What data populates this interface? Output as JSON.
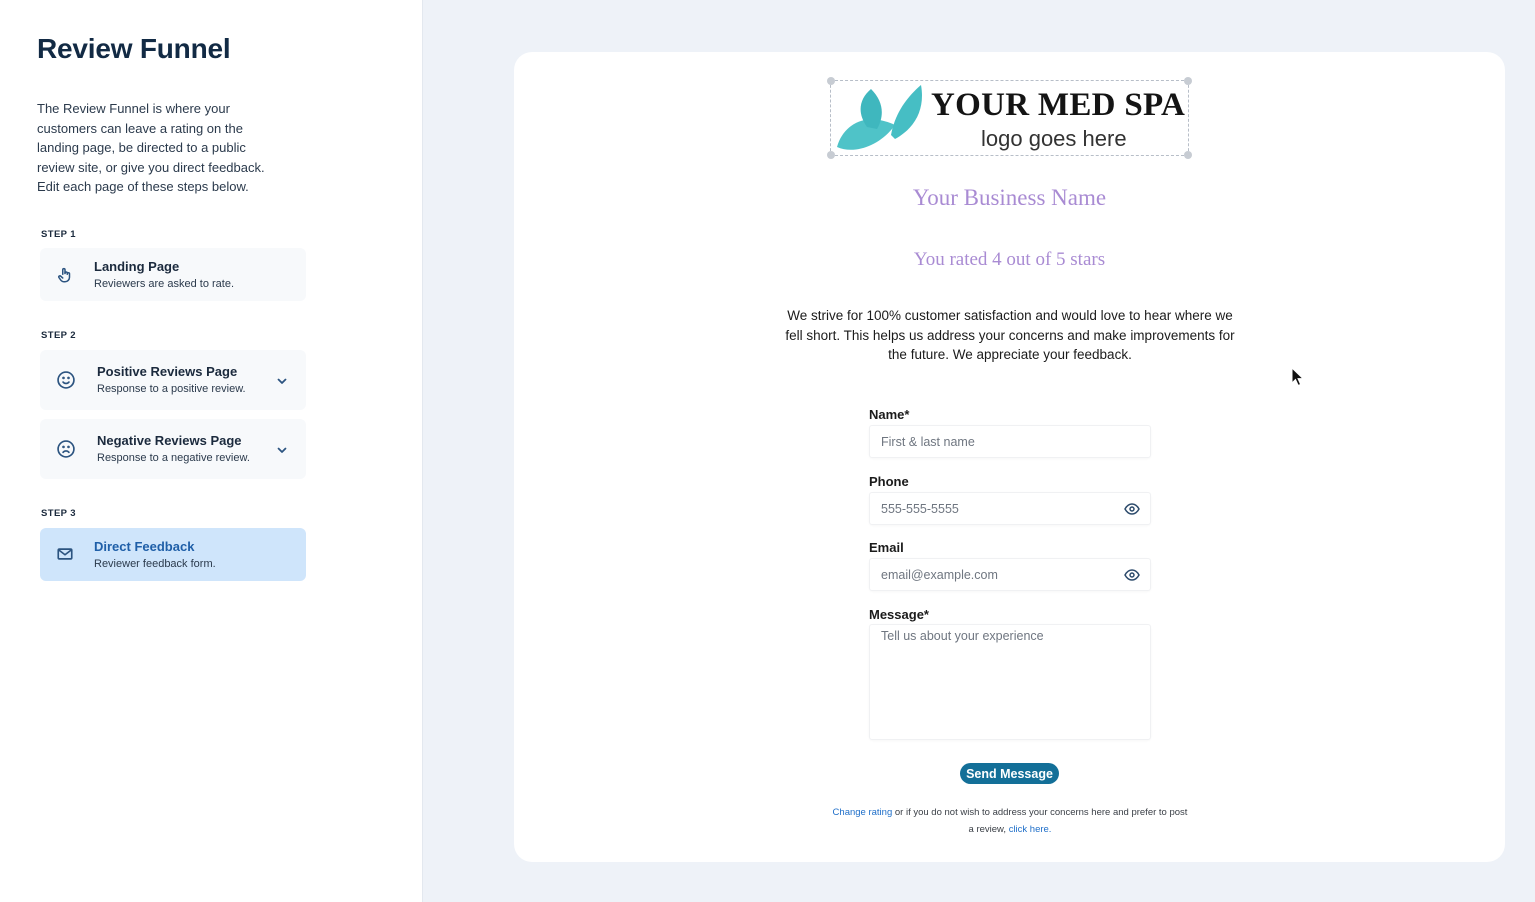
{
  "sidebar": {
    "title": "Review Funnel",
    "description": "The Review Funnel is where your customers can leave a rating on the landing page, be directed to a public review site, or give you direct feedback. Edit each page of these steps below.",
    "steps": [
      {
        "label": "STEP 1",
        "items": [
          {
            "name": "Landing Page",
            "sub": "Reviewers are asked to rate.",
            "icon": "hand-pointer-icon"
          }
        ]
      },
      {
        "label": "STEP 2",
        "items": [
          {
            "name": "Positive Reviews Page",
            "sub": "Response to a positive review.",
            "icon": "smile-icon"
          },
          {
            "name": "Negative Reviews Page",
            "sub": "Response to a negative review.",
            "icon": "frown-icon"
          }
        ]
      },
      {
        "label": "STEP 3",
        "items": [
          {
            "name": "Direct Feedback",
            "sub": "Reviewer feedback form.",
            "icon": "envelope-icon",
            "active": true
          }
        ]
      }
    ]
  },
  "preview": {
    "logo": {
      "main": "YOUR MED SPA",
      "sub": "logo goes here"
    },
    "business_name": "Your Business Name",
    "rating_text": "You rated 4 out of 5 stars",
    "intro": "We strive for 100% customer satisfaction and would love to hear where we fell short. This helps us address your concerns and make improvements for the future. We appreciate your feedback.",
    "form": {
      "name_label": "Name*",
      "name_placeholder": "First & last name",
      "phone_label": "Phone",
      "phone_placeholder": "555-555-5555",
      "email_label": "Email",
      "email_placeholder": "email@example.com",
      "message_label": "Message*",
      "message_placeholder": "Tell us about your experience",
      "send_label": "Send Message"
    },
    "footer": {
      "change_link": "Change rating",
      "middle": " or if you do not wish to address your concerns here and prefer to post a review, ",
      "click_link": "click here."
    }
  },
  "colors": {
    "accent": "#136f98",
    "brand_purple": "#a98bd3",
    "active_step_bg": "#cfe5fb",
    "logo_leaf": "#4fc3c8"
  }
}
